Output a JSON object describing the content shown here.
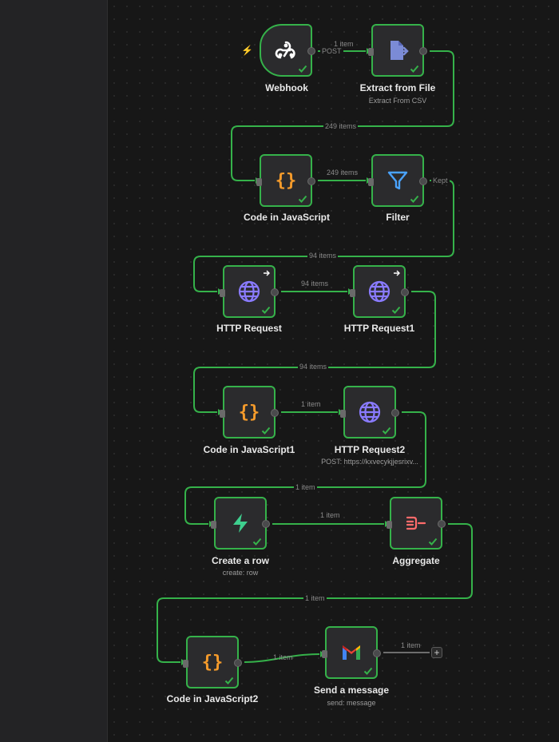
{
  "nodes": {
    "webhook": {
      "name": "Webhook",
      "sub": ""
    },
    "extract": {
      "name": "Extract from File",
      "sub": "Extract From CSV"
    },
    "code1": {
      "name": "Code in JavaScript",
      "sub": ""
    },
    "filter": {
      "name": "Filter",
      "sub": ""
    },
    "http": {
      "name": "HTTP Request",
      "sub": ""
    },
    "http1": {
      "name": "HTTP Request1",
      "sub": ""
    },
    "code2": {
      "name": "Code in JavaScript1",
      "sub": ""
    },
    "http2": {
      "name": "HTTP Request2",
      "sub": "POST: https://kxvecykjjesrixv..."
    },
    "create": {
      "name": "Create a row",
      "sub": "create: row"
    },
    "aggregate": {
      "name": "Aggregate",
      "sub": ""
    },
    "code3": {
      "name": "Code in JavaScript2",
      "sub": ""
    },
    "gmail": {
      "name": "Send a message",
      "sub": "send: message"
    }
  },
  "edges": {
    "e1": "1 item",
    "e1_method": "POST",
    "e2": "249 items",
    "e3": "249 items",
    "e3_branch": "Kept",
    "e4": "94 items",
    "e5": "94 items",
    "e6": "94 items",
    "e7": "1 item",
    "e8": "1 item",
    "e9": "1 item",
    "e10": "1 item",
    "e11": "1 item",
    "e12": "1 item"
  },
  "colors": {
    "success": "#35b24a",
    "code": "#f59b2b",
    "http": "#8a7bff",
    "filter": "#4aa3ff",
    "supabase": "#3ecf8e",
    "aggregate": "#ff6b6b"
  }
}
